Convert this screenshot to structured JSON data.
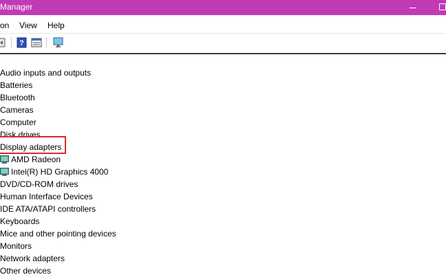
{
  "window": {
    "title": "Manager"
  },
  "menu": {
    "items": [
      "on",
      "View",
      "Help"
    ]
  },
  "toolbar": {
    "buttons": [
      "back-icon",
      "help-icon",
      "properties-icon",
      "monitor-icon"
    ]
  },
  "tree": {
    "nodes": [
      {
        "label": "Audio inputs and outputs"
      },
      {
        "label": "Batteries"
      },
      {
        "label": "Bluetooth"
      },
      {
        "label": "Cameras"
      },
      {
        "label": "Computer"
      },
      {
        "label": "Disk drives"
      },
      {
        "label": "Display adapters",
        "highlighted": true
      },
      {
        "label": "AMD Radeon",
        "child": true
      },
      {
        "label": "Intel(R) HD Graphics 4000",
        "child": true
      },
      {
        "label": "DVD/CD-ROM drives"
      },
      {
        "label": "Human Interface Devices"
      },
      {
        "label": "IDE ATA/ATAPI controllers"
      },
      {
        "label": "Keyboards"
      },
      {
        "label": "Mice and other pointing devices"
      },
      {
        "label": "Monitors"
      },
      {
        "label": "Network adapters"
      },
      {
        "label": "Other devices"
      }
    ]
  },
  "colors": {
    "titlebar": "#c13ab5",
    "highlight_box": "#d42a2a"
  }
}
